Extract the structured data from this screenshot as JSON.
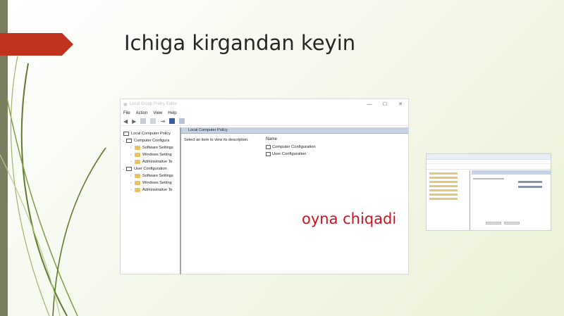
{
  "slide": {
    "title": "Ichiga kirgandan keyin",
    "caption": "oyna chiqadi",
    "accent_red": "#c0321c",
    "caption_color": "#d40f1e"
  },
  "window": {
    "title": "Local Group Policy Editor",
    "controls": [
      "—",
      "☐",
      "✕"
    ],
    "menu": [
      "File",
      "Action",
      "View",
      "Help"
    ],
    "tree": {
      "root": "Local Computer Policy",
      "computer_config": "Computer Configura",
      "computer_children": [
        "Software Settings",
        "Windows Setting",
        "Administrative Te"
      ],
      "user_config": "User Configuration",
      "user_children": [
        "Software Settings",
        "Windows Setting",
        "Administrative Te"
      ]
    },
    "right_header": "Local Computer Policy",
    "description": "Select an item to view its description.",
    "column_name": "Name",
    "items": [
      "Computer Configuration",
      "User Configuration"
    ]
  }
}
